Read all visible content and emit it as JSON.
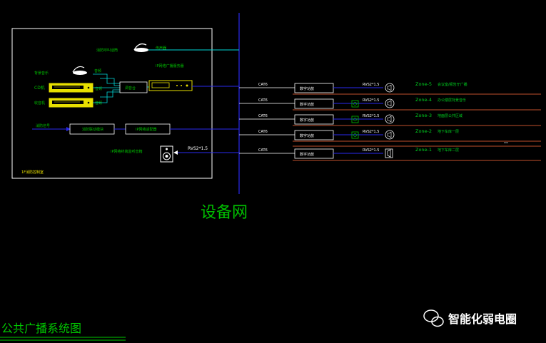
{
  "colors": {
    "background": "#000000",
    "frame": "#ffffff",
    "network_line": "#2a2af0",
    "cyan": "#00d8d8",
    "green": "#00c000",
    "yellow": "#e8e000",
    "zone_text": "#00d020",
    "zone_divider": "#ff6a3a",
    "title": "#00c800",
    "label": "#ff3030",
    "watermark": "#ffffff"
  },
  "control_room": {
    "label": "1F消防控制室",
    "mic_label": "传声器",
    "mic_device_label": "消防呼叫话筒",
    "background_music_label": "背景音乐",
    "cd_label": "CD机",
    "tuner_label": "收音机",
    "mixer_label": "调音台",
    "ip_server_label": "IP网络广播服务器",
    "fire_signal_label": "消防信号",
    "fire_module_label": "消防联动模块",
    "ip_adapter_label": "IP网络适配器",
    "monitor_speaker_label": "IP网络终端监听音箱",
    "small_signal": "音频"
  },
  "network": {
    "label": "设备网"
  },
  "branches": [
    {
      "cable": "CAT6",
      "terminal": "数字功放",
      "speaker_cable": "RVS2*1.5",
      "zone": "Zone-5",
      "zone_desc": "会议室/报告厅广播"
    },
    {
      "cable": "CAT6",
      "terminal": "数字功放",
      "speaker_cable": "RVS2*1.5",
      "zone": "Zone-4",
      "zone_desc": "办公楼层背景音乐"
    },
    {
      "cable": "CAT6",
      "terminal": "数字功放",
      "speaker_cable": "RVS2*1.5",
      "zone": "Zone-3",
      "zone_desc": "地面层公共区域"
    },
    {
      "cable": "CAT6",
      "terminal": "数字功放",
      "speaker_cable": "RVS2*1.5",
      "zone": "Zone-2",
      "zone_desc": "地下车库一层"
    },
    {
      "cable": "CAT6",
      "terminal": "数字功放",
      "speaker_cable": "RVS2*1.5",
      "zone": "Zone-1",
      "zone_desc": "地下车库二层"
    }
  ],
  "monitor_cable": "RVS2*1.5",
  "title": "公共广播系统图",
  "watermark": "智能化弱电圈"
}
